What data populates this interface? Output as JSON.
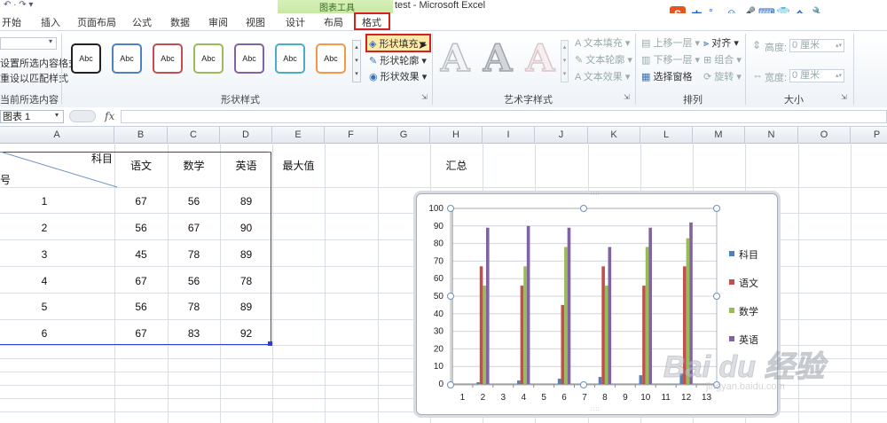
{
  "window": {
    "title": "test - Microsoft Excel",
    "context_group": "图表工具",
    "ime_icons": [
      "中",
      "°,",
      "☺",
      "🎤",
      "⌨",
      "👕",
      "全",
      "🔧"
    ],
    "ime_logo": "S"
  },
  "tabs": [
    {
      "label": "开始"
    },
    {
      "label": "插入"
    },
    {
      "label": "页面布局"
    },
    {
      "label": "公式"
    },
    {
      "label": "数据"
    },
    {
      "label": "审阅"
    },
    {
      "label": "视图"
    },
    {
      "label": "设计"
    },
    {
      "label": "布局"
    },
    {
      "label": "格式"
    }
  ],
  "ribbon": {
    "current_selection": {
      "item1": "设置所选内容格式",
      "item2": "重设以匹配样式",
      "group": "当前所选内容"
    },
    "shape_styles": {
      "group": "形状样式",
      "sample_text": "Abc",
      "fill": "形状填充",
      "outline": "形状轮廓",
      "effects": "形状效果"
    },
    "wordart": {
      "group": "艺术字样式",
      "text_fill": "文本填充",
      "text_outline": "文本轮廓",
      "text_effects": "文本效果",
      "sample": "A"
    },
    "arrange": {
      "group": "排列",
      "bring_forward": "上移一层",
      "send_backward": "下移一层",
      "selection_pane": "选择窗格",
      "align": "对齐",
      "group_btn": "组合",
      "rotate": "旋转"
    },
    "size": {
      "group": "大小",
      "height_label": "高度:",
      "height_value": "0 厘米",
      "width_label": "宽度:",
      "width_value": "0 厘米"
    }
  },
  "formula_bar": {
    "name_box": "图表 1",
    "fx": "fx",
    "content": ""
  },
  "sheet": {
    "columns": [
      "A",
      "B",
      "C",
      "D",
      "E",
      "F",
      "G",
      "H",
      "I",
      "J",
      "K",
      "L",
      "M",
      "N",
      "O",
      "P"
    ],
    "header_top": "科目",
    "header_bottom": "号",
    "headers": [
      "语文",
      "数学",
      "英语",
      "最大值"
    ],
    "summary_label": "汇总",
    "rows": [
      {
        "id": "1",
        "values": [
          "67",
          "56",
          "89"
        ]
      },
      {
        "id": "2",
        "values": [
          "56",
          "67",
          "90"
        ]
      },
      {
        "id": "3",
        "values": [
          "45",
          "78",
          "89"
        ]
      },
      {
        "id": "4",
        "values": [
          "67",
          "56",
          "78"
        ]
      },
      {
        "id": "5",
        "values": [
          "56",
          "78",
          "89"
        ]
      },
      {
        "id": "6",
        "values": [
          "67",
          "83",
          "92"
        ]
      }
    ]
  },
  "colors": {
    "科目": "#4f81bd",
    "语文": "#c0504d",
    "数学": "#9bbb59",
    "英语": "#8064a2",
    "selection": "#d32020"
  },
  "chart_data": {
    "type": "bar",
    "categories": [
      "1",
      "2",
      "3",
      "4",
      "5",
      "6",
      "7",
      "8",
      "9",
      "10",
      "11",
      "12",
      "13"
    ],
    "ylim": [
      0,
      100
    ],
    "yticks": [
      "0",
      "10",
      "20",
      "30",
      "40",
      "50",
      "60",
      "70",
      "80",
      "90",
      "100"
    ],
    "series": [
      {
        "name": "科目",
        "values": [
          0,
          1,
          0,
          2,
          0,
          3,
          0,
          4,
          0,
          5,
          0,
          6,
          0
        ]
      },
      {
        "name": "语文",
        "values": [
          0,
          67,
          0,
          56,
          0,
          45,
          0,
          67,
          0,
          56,
          0,
          67,
          0
        ]
      },
      {
        "name": "数学",
        "values": [
          0,
          56,
          0,
          67,
          0,
          78,
          0,
          56,
          0,
          78,
          0,
          83,
          0
        ]
      },
      {
        "name": "英语",
        "values": [
          0,
          89,
          0,
          90,
          0,
          89,
          0,
          78,
          0,
          89,
          0,
          92,
          0
        ]
      }
    ],
    "legend_position": "right",
    "grid": true
  },
  "watermark": {
    "text": "Bai du 经验",
    "sub": "jingyan.baidu.com"
  }
}
